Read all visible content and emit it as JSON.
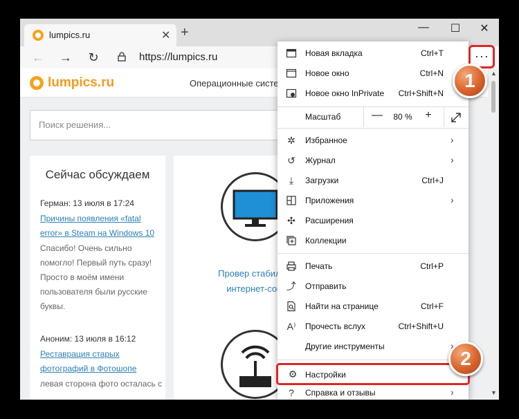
{
  "browser": {
    "tab": {
      "title": "lumpics.ru"
    },
    "url": "https://lumpics.ru",
    "window_controls": {
      "minimize": "—",
      "maximize": "☐",
      "close": "✕"
    },
    "more_button": "···"
  },
  "site": {
    "logo": "lumpics.ru",
    "nav": "Операционные систем",
    "search_placeholder": "Поиск решения...",
    "discussion": {
      "title": "Сейчас обсуждаем",
      "comments": [
        {
          "meta": "Герман: 13 июля в 17:24",
          "link": "Причины появления «fatal error» в Steam на Windows 10",
          "text": "Спасибо! Очень сильно помогло! Первый путь сразу! Просто в моём имени пользователя были русские буквы."
        },
        {
          "meta": "Аноним: 13 июля в 16:12",
          "link": "Реставрация старых фотографий в Фотошопе",
          "text": "левая сторона фото осталась с"
        }
      ]
    },
    "article_teaser": "Провер стабильно интернет-соед"
  },
  "menu": {
    "items": [
      {
        "icon": "new-tab-icon",
        "label": "Новая вкладка",
        "shortcut": "Ctrl+T"
      },
      {
        "icon": "new-window-icon",
        "label": "Новое окно",
        "shortcut": "Ctrl+N"
      },
      {
        "icon": "inprivate-icon",
        "label": "Новое окно InPrivate",
        "shortcut": "Ctrl+Shift+N"
      },
      {
        "icon": "star-list-icon",
        "label": "Избранное",
        "shortcut": ""
      },
      {
        "icon": "history-icon",
        "label": "Журнал",
        "shortcut": ""
      },
      {
        "icon": "download-icon",
        "label": "Загрузки",
        "shortcut": "Ctrl+J"
      },
      {
        "icon": "apps-icon",
        "label": "Приложения",
        "shortcut": ""
      },
      {
        "icon": "extensions-icon",
        "label": "Расширения",
        "shortcut": ""
      },
      {
        "icon": "collections-icon",
        "label": "Коллекции",
        "shortcut": ""
      },
      {
        "icon": "print-icon",
        "label": "Печать",
        "shortcut": "Ctrl+P"
      },
      {
        "icon": "share-icon",
        "label": "Отправить",
        "shortcut": ""
      },
      {
        "icon": "find-icon",
        "label": "Найти на странице",
        "shortcut": "Ctrl+F"
      },
      {
        "icon": "read-aloud-icon",
        "label": "Прочесть вслух",
        "shortcut": "Ctrl+Shift+U"
      },
      {
        "icon": "",
        "label": "Другие инструменты",
        "shortcut": ""
      },
      {
        "icon": "gear-icon",
        "label": "Настройки",
        "shortcut": ""
      },
      {
        "icon": "help-icon",
        "label": "Справка и отзывы",
        "shortcut": ""
      }
    ],
    "zoom": {
      "label": "Масштаб",
      "minus": "—",
      "value": "80 %",
      "plus": "+"
    }
  },
  "badges": {
    "step1": "1",
    "step2": "2"
  }
}
